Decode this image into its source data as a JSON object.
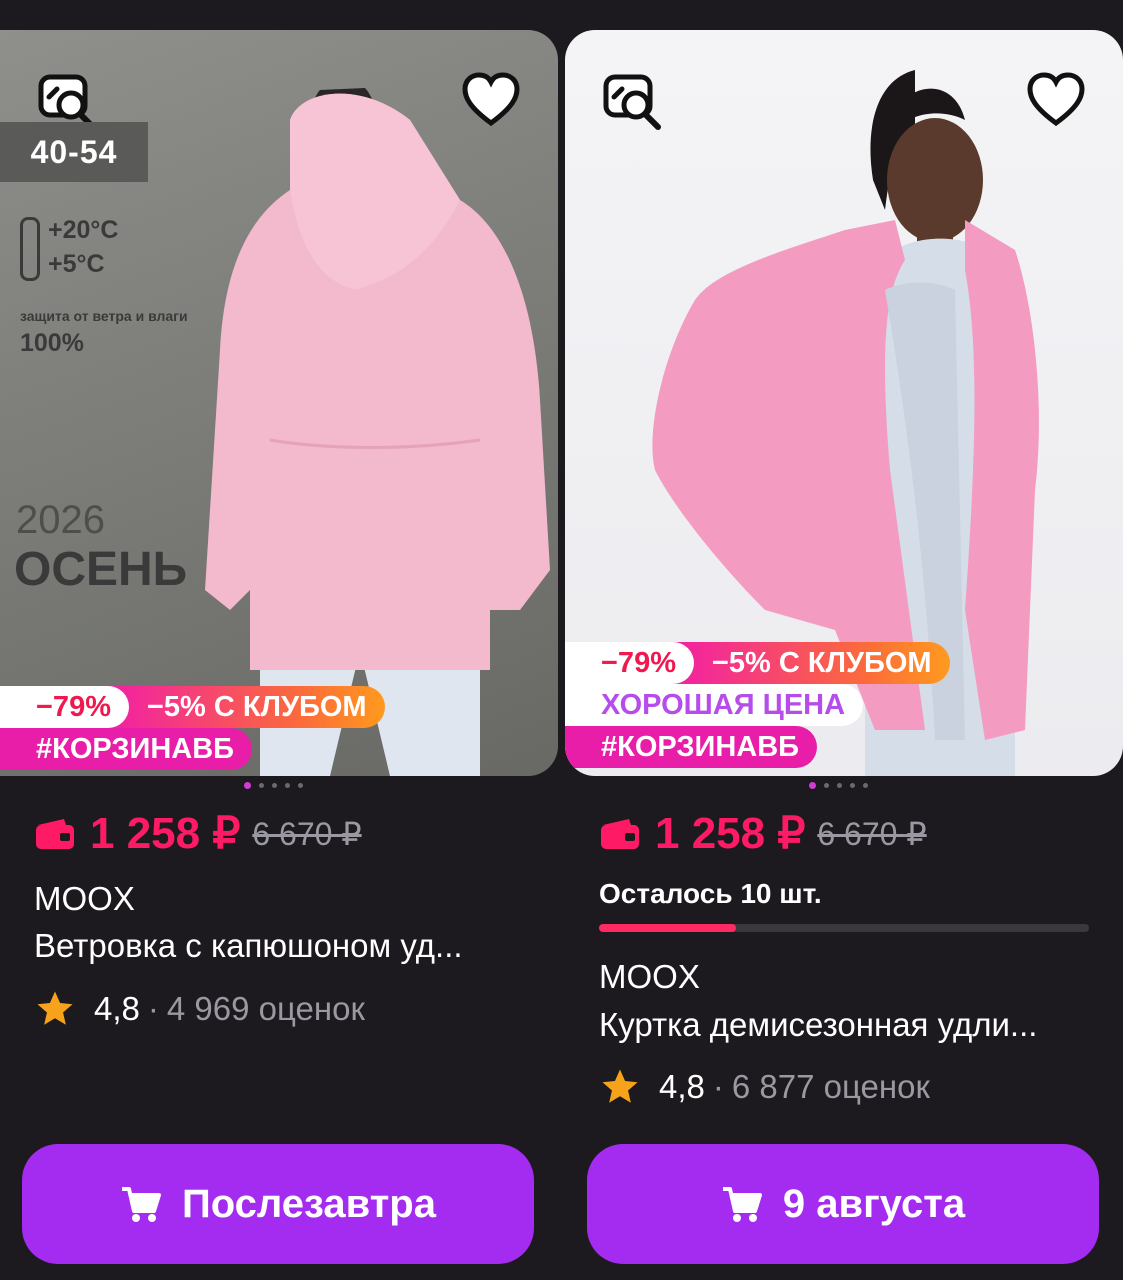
{
  "products": [
    {
      "photo": {
        "size_range": "40-54",
        "temp_high": "+20°C",
        "temp_low": "+5°C",
        "protection_text": "защита от ветра и влаги",
        "protection_pct": "100%",
        "year": "2026",
        "season": "ОСЕНЬ"
      },
      "badges": {
        "discount": "−79%",
        "club": "−5% С КЛУБОМ",
        "tag": "#КОРЗИНАВБ"
      },
      "carousel_index": 1,
      "carousel_count": 5,
      "price": "1 258 ₽",
      "old_price": "6 670 ₽",
      "brand": "MOOX",
      "title": "Ветровка с капюшоном уд...",
      "rating": "4,8",
      "reviews": "4 969 оценок",
      "button_label": "Послезавтра"
    },
    {
      "badges": {
        "discount": "−79%",
        "club": "−5% С КЛУБОМ",
        "good_price": "ХОРОШАЯ ЦЕНА",
        "tag": "#КОРЗИНАВБ"
      },
      "carousel_index": 1,
      "carousel_count": 5,
      "price": "1 258 ₽",
      "old_price": "6 670 ₽",
      "stock": "Осталось 10 шт.",
      "stock_fraction": 0.28,
      "brand": "MOOX",
      "title": "Куртка демисезонная удли...",
      "rating": "4,8",
      "reviews": "6 877 оценок",
      "button_label": "9 августа"
    }
  ],
  "colors": {
    "price": "#ff1a66",
    "button": "#a42bf0",
    "tag": "#e81ea8",
    "star": "#f7a21b"
  },
  "icons": [
    "similar-search-icon",
    "heart-icon",
    "wallet-icon",
    "star-icon",
    "cart-icon"
  ]
}
